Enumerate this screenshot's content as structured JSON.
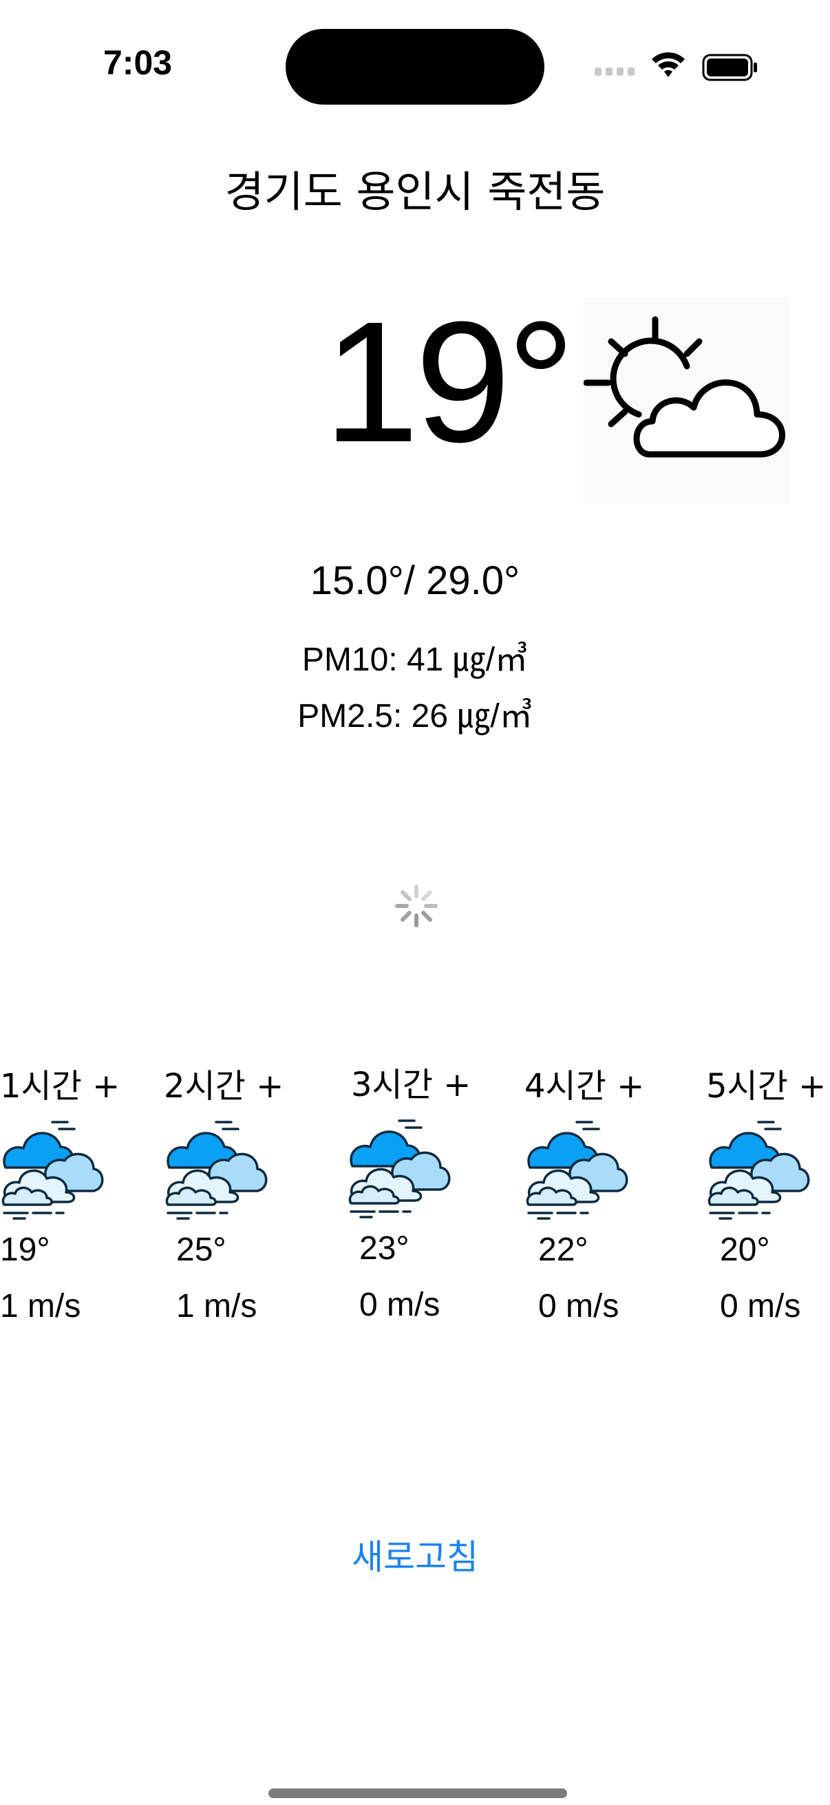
{
  "status_bar": {
    "time": "7:03",
    "signal_icon": "cellular-signal-icon",
    "wifi_icon": "wifi-icon",
    "battery_icon": "battery-icon"
  },
  "location": "경기도 용인시 죽전동",
  "current": {
    "temperature": "19°",
    "icon": "partly-cloudy-sun-icon",
    "min_max": "15.0°/ 29.0°",
    "pm10": "PM10: 41 ㎍/㎥",
    "pm25": "PM2.5: 26 ㎍/㎥"
  },
  "loading_indicator": "activity-spinner-icon",
  "hourly": [
    {
      "label": "1시간 +",
      "temp": "19°",
      "wind": "1 m/s",
      "icon": "cloudy-icon"
    },
    {
      "label": "2시간 +",
      "temp": "25°",
      "wind": "1 m/s",
      "icon": "cloudy-icon"
    },
    {
      "label": "3시간 +",
      "temp": "23°",
      "wind": "0 m/s",
      "icon": "cloudy-icon"
    },
    {
      "label": "4시간 +",
      "temp": "22°",
      "wind": "0 m/s",
      "icon": "cloudy-icon"
    },
    {
      "label": "5시간 +",
      "temp": "20°",
      "wind": "0 m/s",
      "icon": "cloudy-icon"
    }
  ],
  "refresh_label": "새로고침",
  "colors": {
    "accent": "#1a82f5",
    "cloud_dark": "#0aa0f5",
    "cloud_light": "#a9dcfa",
    "cloud_pale": "#e3f4fd",
    "home_indicator": "#7c7c7c"
  }
}
